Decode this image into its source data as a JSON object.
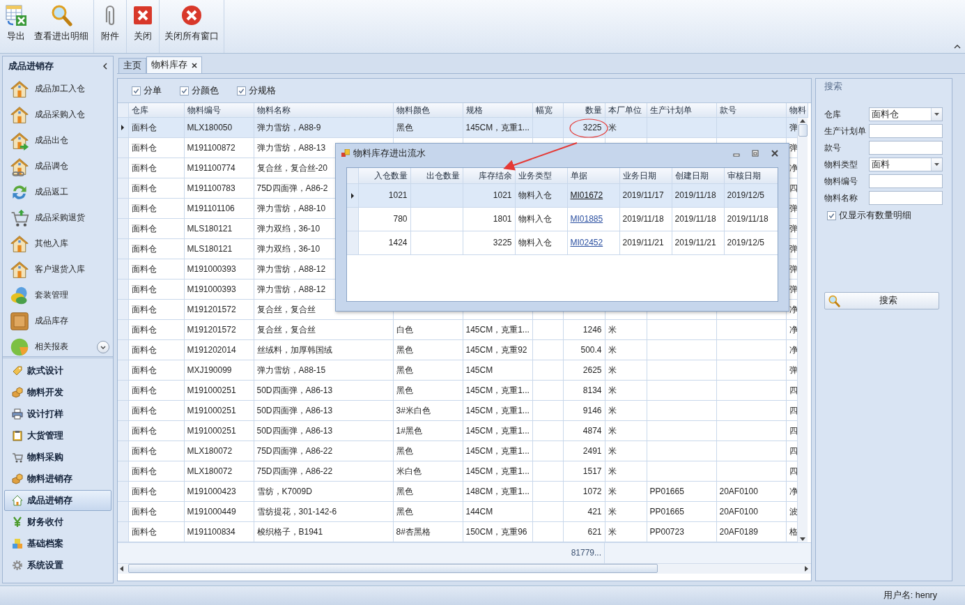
{
  "toolbar": {
    "groups": [
      [
        {
          "label": "导出",
          "kind": "export"
        },
        {
          "label": "查看进出明细",
          "kind": "view"
        }
      ],
      [
        {
          "label": "附件",
          "kind": "attach"
        }
      ],
      [
        {
          "label": "关闭",
          "kind": "close"
        }
      ],
      [
        {
          "label": "关闭所有窗口",
          "kind": "close-all"
        }
      ]
    ]
  },
  "sidebar": {
    "title": "成品进销存",
    "items": [
      {
        "label": "成品加工入仓",
        "kind": "house"
      },
      {
        "label": "成品采购入仓",
        "kind": "house"
      },
      {
        "label": "成品出仓",
        "kind": "house-arrow"
      },
      {
        "label": "成品调仓",
        "kind": "house-link"
      },
      {
        "label": "成品返工",
        "kind": "refresh"
      },
      {
        "label": "成品采购退货",
        "kind": "cart"
      },
      {
        "label": "其他入库",
        "kind": "house"
      },
      {
        "label": "客户退货入库",
        "kind": "house"
      },
      {
        "label": "套装管理",
        "kind": "circles"
      },
      {
        "label": "成品库存",
        "kind": "box"
      },
      {
        "label": "相关报表",
        "kind": "pie"
      }
    ]
  },
  "nav": [
    {
      "label": "款式设计",
      "kind": "tag",
      "selected": false
    },
    {
      "label": "物料开发",
      "kind": "boxes",
      "selected": false
    },
    {
      "label": "设计打样",
      "kind": "printer",
      "selected": false
    },
    {
      "label": "大货管理",
      "kind": "clipboard",
      "selected": false
    },
    {
      "label": "物料采购",
      "kind": "cart",
      "selected": false
    },
    {
      "label": "物料进销存",
      "kind": "boxes",
      "selected": false
    },
    {
      "label": "成品进销存",
      "kind": "house",
      "selected": true
    },
    {
      "label": "财务收付",
      "kind": "yen",
      "selected": false
    },
    {
      "label": "基础档案",
      "kind": "cubes",
      "selected": false
    },
    {
      "label": "系统设置",
      "kind": "gear",
      "selected": false
    }
  ],
  "tabs": [
    {
      "label": "主页",
      "selected": false,
      "closable": false
    },
    {
      "label": "物料库存",
      "selected": true,
      "closable": true
    }
  ],
  "options": [
    {
      "label": "分单",
      "checked": true
    },
    {
      "label": "分颜色",
      "checked": true
    },
    {
      "label": "分规格",
      "checked": true
    }
  ],
  "grid": {
    "columns": [
      {
        "label": "仓库",
        "kind": "text"
      },
      {
        "label": "物料编号",
        "kind": "text"
      },
      {
        "label": "物料名称",
        "kind": "text"
      },
      {
        "label": "物料颜色",
        "kind": "text"
      },
      {
        "label": "规格",
        "kind": "text"
      },
      {
        "label": "幅宽",
        "kind": "text"
      },
      {
        "label": "数量",
        "kind": "number"
      },
      {
        "label": "本厂单位",
        "kind": "text"
      },
      {
        "label": "生产计划单",
        "kind": "text"
      },
      {
        "label": "款号",
        "kind": "text"
      },
      {
        "label": "物料",
        "kind": "text"
      }
    ],
    "rows": [
      {
        "selected": true,
        "cells": [
          "面料仓",
          "MLX180050",
          "弹力雪纺，A88-9",
          "黑色",
          "145CM，克重1...",
          null,
          "3225",
          "米",
          null,
          null,
          "弹"
        ]
      },
      {
        "selected": false,
        "cells": [
          "面料仓",
          "M191100872",
          "弹力雪纺，A88-13",
          null,
          null,
          null,
          null,
          null,
          null,
          null,
          "弹"
        ]
      },
      {
        "selected": false,
        "cells": [
          "面料仓",
          "M191100774",
          "复合丝，复合丝-20",
          null,
          null,
          null,
          null,
          null,
          null,
          null,
          "净"
        ]
      },
      {
        "selected": false,
        "cells": [
          "面料仓",
          "M191100783",
          "75D四面弹，A86-2",
          null,
          null,
          null,
          null,
          null,
          null,
          null,
          "四"
        ]
      },
      {
        "selected": false,
        "cells": [
          "面料仓",
          "M191101106",
          "弹力雪纺，A88-10",
          null,
          null,
          null,
          null,
          null,
          null,
          null,
          "弹"
        ]
      },
      {
        "selected": false,
        "cells": [
          "面料仓",
          "MLS180121",
          "弹力双绉，36-10",
          null,
          null,
          null,
          null,
          null,
          null,
          null,
          "弹"
        ]
      },
      {
        "selected": false,
        "cells": [
          "面料仓",
          "MLS180121",
          "弹力双绉，36-10",
          null,
          null,
          null,
          null,
          null,
          null,
          null,
          "弹"
        ]
      },
      {
        "selected": false,
        "cells": [
          "面料仓",
          "M191000393",
          "弹力雪纺，A88-12",
          null,
          null,
          null,
          null,
          null,
          null,
          null,
          "弹"
        ]
      },
      {
        "selected": false,
        "cells": [
          "面料仓",
          "M191000393",
          "弹力雪纺，A88-12",
          null,
          null,
          null,
          null,
          null,
          null,
          null,
          "弹"
        ]
      },
      {
        "selected": false,
        "cells": [
          "面料仓",
          "M191201572",
          "复合丝，复合丝",
          null,
          null,
          null,
          null,
          null,
          null,
          null,
          "净"
        ]
      },
      {
        "selected": false,
        "cells": [
          "面料仓",
          "M191201572",
          "复合丝，复合丝",
          "白色",
          "145CM，克重1...",
          null,
          "1246",
          "米",
          null,
          null,
          "净"
        ]
      },
      {
        "selected": false,
        "cells": [
          "面料仓",
          "M191202014",
          "丝绒料，加厚韩国绒",
          "黑色",
          "145CM，克重92",
          null,
          "500.4",
          "米",
          null,
          null,
          "净"
        ]
      },
      {
        "selected": false,
        "cells": [
          "面料仓",
          "MXJ190099",
          "弹力雪纺，A88-15",
          "黑色",
          "145CM",
          null,
          "2625",
          "米",
          null,
          null,
          "弹"
        ]
      },
      {
        "selected": false,
        "cells": [
          "面料仓",
          "M191000251",
          "50D四面弹，A86-13",
          "黑色",
          "145CM，克重1...",
          null,
          "8134",
          "米",
          null,
          null,
          "四"
        ]
      },
      {
        "selected": false,
        "cells": [
          "面料仓",
          "M191000251",
          "50D四面弹，A86-13",
          "3#米白色",
          "145CM，克重1...",
          null,
          "9146",
          "米",
          null,
          null,
          "四"
        ]
      },
      {
        "selected": false,
        "cells": [
          "面料仓",
          "M191000251",
          "50D四面弹，A86-13",
          "1#黑色",
          "145CM，克重1...",
          null,
          "4874",
          "米",
          null,
          null,
          "四"
        ]
      },
      {
        "selected": false,
        "cells": [
          "面料仓",
          "MLX180072",
          "75D四面弹，A86-22",
          "黑色",
          "145CM，克重1...",
          null,
          "2491",
          "米",
          null,
          null,
          "四"
        ]
      },
      {
        "selected": false,
        "cells": [
          "面料仓",
          "MLX180072",
          "75D四面弹，A86-22",
          "米白色",
          "145CM，克重1...",
          null,
          "1517",
          "米",
          null,
          null,
          "四"
        ]
      },
      {
        "selected": false,
        "cells": [
          "面料仓",
          "M191000423",
          "雪纺，K7009D",
          "黑色",
          "148CM，克重1...",
          null,
          "1072",
          "米",
          "PP01665",
          "20AF0100",
          "净"
        ]
      },
      {
        "selected": false,
        "cells": [
          "面料仓",
          "M191000449",
          "雪纺提花，301-142-6",
          "黑色",
          "144CM",
          null,
          "421",
          "米",
          "PP01665",
          "20AF0100",
          "波"
        ]
      },
      {
        "selected": false,
        "cells": [
          "面料仓",
          "M191100834",
          "梭织格子，B1941",
          "8#杏黑格",
          "150CM，克重96",
          null,
          "621",
          "米",
          "PP00723",
          "20AF0189",
          "格"
        ]
      }
    ],
    "total": "81779..."
  },
  "dialog": {
    "title": "物料库存进出流水",
    "columns": [
      {
        "label": "入仓数量",
        "kind": "number"
      },
      {
        "label": "出仓数量",
        "kind": "number"
      },
      {
        "label": "库存结余",
        "kind": "number"
      },
      {
        "label": "业务类型",
        "kind": "text"
      },
      {
        "label": "单据",
        "kind": "link"
      },
      {
        "label": "业务日期",
        "kind": "text"
      },
      {
        "label": "创建日期",
        "kind": "text"
      },
      {
        "label": "审核日期",
        "kind": "text"
      }
    ],
    "rows": [
      {
        "selected": true,
        "cells": [
          "1021",
          null,
          "1021",
          "物料入仓",
          "MI01672",
          "2019/11/17",
          "2019/11/18",
          "2019/12/5"
        ]
      },
      {
        "selected": false,
        "cells": [
          "780",
          null,
          "1801",
          "物料入仓",
          "MI01885",
          "2019/11/18",
          "2019/11/18",
          "2019/11/18"
        ]
      },
      {
        "selected": false,
        "cells": [
          "1424",
          null,
          "3225",
          "物料入仓",
          "MI02452",
          "2019/11/21",
          "2019/11/21",
          "2019/12/5"
        ]
      }
    ]
  },
  "search": {
    "title": "搜索",
    "fields": [
      {
        "label": "仓库",
        "kind": "select",
        "value": "面料仓"
      },
      {
        "label": "生产计划单",
        "kind": "input"
      },
      {
        "label": "款号",
        "kind": "input"
      },
      {
        "label": "物料类型",
        "kind": "select",
        "value": "面料"
      },
      {
        "label": "物料编号",
        "kind": "input"
      },
      {
        "label": "物料名称",
        "kind": "input"
      }
    ],
    "option": {
      "label": "仅显示有数量明细",
      "checked": true
    },
    "button": "搜索"
  },
  "status_bar": {
    "user": "用户名: henry"
  }
}
